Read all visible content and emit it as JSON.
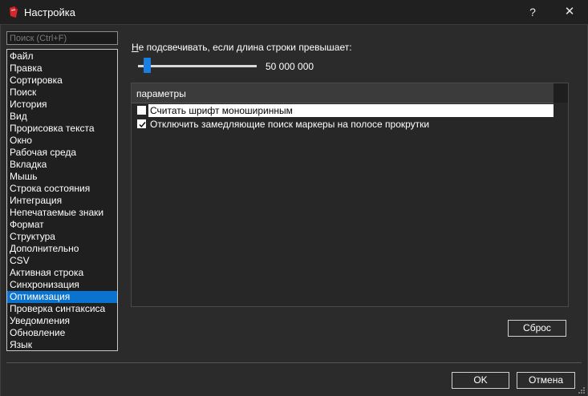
{
  "window": {
    "title": "Настройка",
    "help_label": "?",
    "close_label": "✕"
  },
  "search": {
    "placeholder": "Поиск (Ctrl+F)"
  },
  "nav": {
    "items": [
      {
        "label": "Файл"
      },
      {
        "label": "Правка"
      },
      {
        "label": "Сортировка"
      },
      {
        "label": "Поиск"
      },
      {
        "label": "История"
      },
      {
        "label": "Вид"
      },
      {
        "label": "Прорисовка текста"
      },
      {
        "label": "Окно"
      },
      {
        "label": "Рабочая среда"
      },
      {
        "label": "Вкладка"
      },
      {
        "label": "Мышь"
      },
      {
        "label": "Строка состояния"
      },
      {
        "label": "Интеграция"
      },
      {
        "label": "Непечатаемые знаки"
      },
      {
        "label": "Формат"
      },
      {
        "label": "Структура"
      },
      {
        "label": "Дополнительно"
      },
      {
        "label": "CSV"
      },
      {
        "label": "Активная строка"
      },
      {
        "label": "Синхронизация"
      },
      {
        "label": "Оптимизация"
      },
      {
        "label": "Проверка синтаксиса"
      },
      {
        "label": "Уведомления"
      },
      {
        "label": "Обновление"
      },
      {
        "label": "Язык"
      }
    ],
    "selected_index": 20
  },
  "threshold": {
    "label_accel": "Н",
    "label_rest": "е подсвечивать, если длина строки превышает:",
    "value_text": "50 000 000",
    "slider_level": 0.05
  },
  "params": {
    "header": "параметры",
    "options": [
      {
        "label": "Считать шрифт моноширинным",
        "checked": false
      },
      {
        "label": "Отключить замедляющие поиск маркеры на полосе прокрутки",
        "checked": true
      }
    ]
  },
  "buttons": {
    "reset": "Сброс",
    "ok": "OK",
    "cancel": "Отмена"
  },
  "colors": {
    "accent": "#0a72cf",
    "slider_thumb": "#1a7fe0",
    "background": "#2b2b2b"
  }
}
